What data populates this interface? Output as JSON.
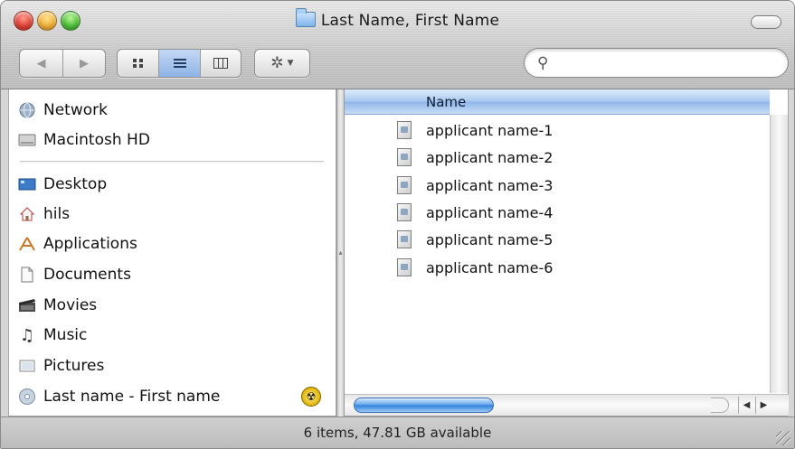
{
  "window": {
    "title": "Last Name, First Name",
    "status_text": "6 items, 47.81 GB available"
  },
  "toolbar": {
    "back_icon": "back-arrow-icon",
    "forward_icon": "forward-arrow-icon",
    "view_modes": [
      "icon-view",
      "list-view",
      "column-view"
    ],
    "active_view": "list-view",
    "action_icon": "gear-icon",
    "search": {
      "value": "",
      "placeholder": ""
    }
  },
  "sidebar": {
    "devices": [
      {
        "label": "Network",
        "icon": "network-icon"
      },
      {
        "label": "Macintosh HD",
        "icon": "hard-drive-icon"
      }
    ],
    "places": [
      {
        "label": "Desktop",
        "icon": "desktop-icon"
      },
      {
        "label": "hils",
        "icon": "home-icon"
      },
      {
        "label": "Applications",
        "icon": "applications-icon"
      },
      {
        "label": "Documents",
        "icon": "documents-icon"
      },
      {
        "label": "Movies",
        "icon": "movies-icon"
      },
      {
        "label": "Music",
        "icon": "music-icon"
      },
      {
        "label": "Pictures",
        "icon": "pictures-icon"
      },
      {
        "label": "Last name - First name",
        "icon": "disc-icon",
        "eject_icon": "burn-icon"
      }
    ]
  },
  "list": {
    "column_header": "Name",
    "items": [
      {
        "name": "applicant name-1",
        "icon": "document-icon"
      },
      {
        "name": "applicant name-2",
        "icon": "document-icon"
      },
      {
        "name": "applicant name-3",
        "icon": "document-icon"
      },
      {
        "name": "applicant name-4",
        "icon": "document-icon"
      },
      {
        "name": "applicant name-5",
        "icon": "document-icon"
      },
      {
        "name": "applicant name-6",
        "icon": "document-icon"
      }
    ]
  }
}
